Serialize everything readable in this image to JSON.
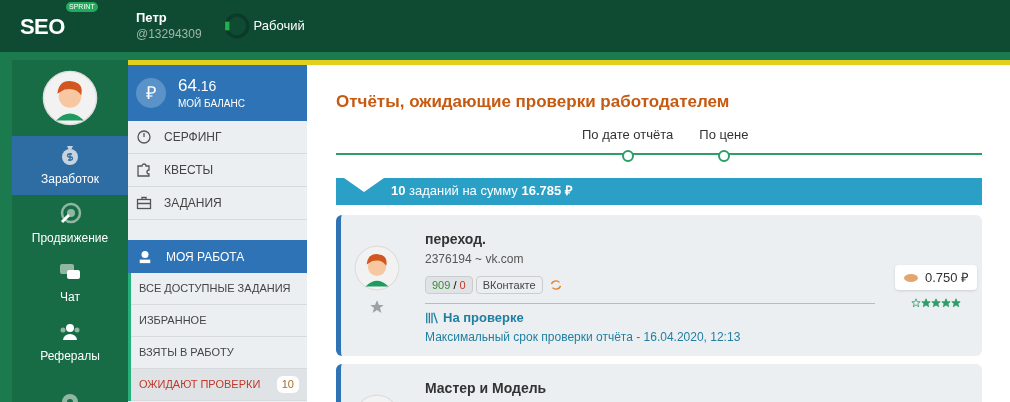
{
  "header": {
    "logo": "SEO",
    "logo_badge": "SPRINT",
    "user_name": "Петр",
    "user_id": "@13294309",
    "status": "Рабочий"
  },
  "rail": [
    {
      "kind": "money",
      "label": "Заработок",
      "selected": true
    },
    {
      "kind": "target",
      "label": "Продвижение",
      "selected": false
    },
    {
      "kind": "chat",
      "label": "Чат",
      "selected": false
    },
    {
      "kind": "users",
      "label": "Рефералы",
      "selected": false
    },
    {
      "kind": "gear",
      "selected": false
    }
  ],
  "balance": {
    "amount": "64",
    "cents": ".16",
    "label": "МОЙ БАЛАНС",
    "currency": "₽"
  },
  "menu": [
    {
      "kind": "clock",
      "label": "СЕРФИНГ"
    },
    {
      "kind": "puzzle",
      "label": "КВЕСТЫ"
    },
    {
      "kind": "case",
      "label": "ЗАДАНИЯ"
    }
  ],
  "my_work": {
    "label": "МОЯ РАБОТА",
    "items": [
      {
        "label": "ВСЕ ДОСТУПНЫЕ ЗАДАНИЯ",
        "selected": false
      },
      {
        "label": "ИЗБРАННОЕ",
        "selected": false
      },
      {
        "label": "ВЗЯТЫ В РАБОТУ",
        "selected": false
      },
      {
        "label": "ОЖИДАЮТ ПРОВЕРКИ",
        "selected": true,
        "count": "10"
      }
    ]
  },
  "title": "Отчёты, ожидающие проверки работодателем",
  "sort": [
    "По дате отчёта",
    "По цене"
  ],
  "summary": "**10** заданий на сумму **16.785 ₽**",
  "tasks": [
    {
      "title": "переход.",
      "subtitle": "2376194 ~ vk.com",
      "good": "909",
      "bad": "0",
      "separator": "/",
      "platform": "ВКонтакте",
      "status": "На проверке",
      "deadline": "Максимальный срок проверки отчёта - 16.04.2020, 12:13",
      "price": "0.750 ₽",
      "stars": 4
    },
    {
      "title": "Мастер и Модель"
    }
  ]
}
